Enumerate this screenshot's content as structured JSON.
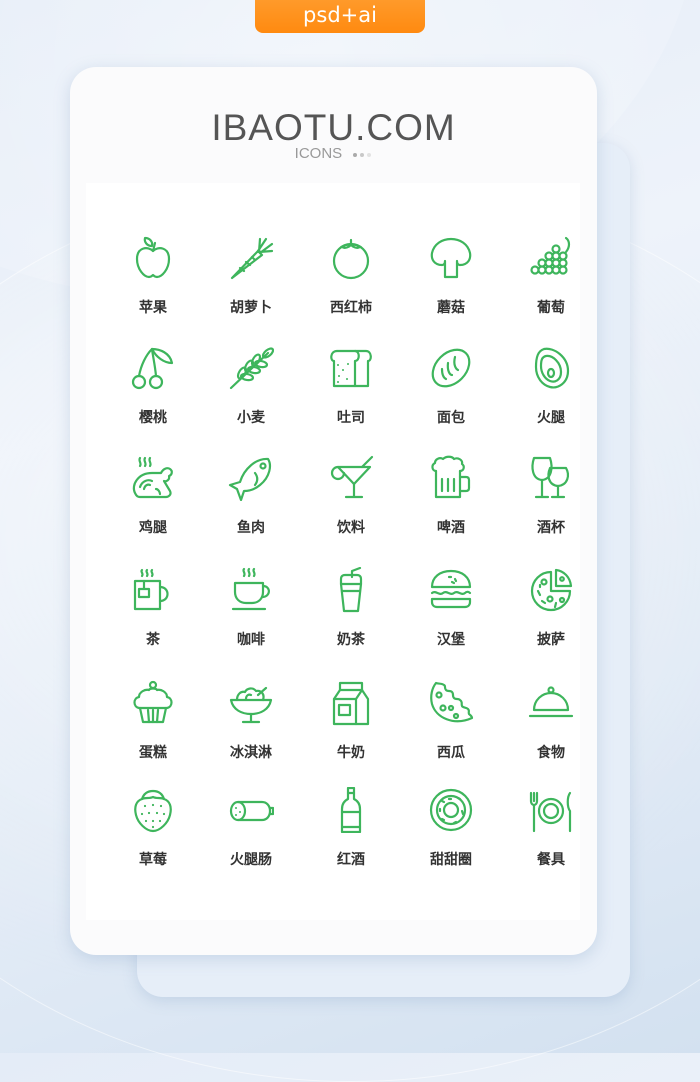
{
  "tag": {
    "label": "psd+ai",
    "color": "#ff8c14"
  },
  "header": {
    "title": "IBAOTU.COM",
    "subtitle": "ICONS",
    "dot_colors": [
      "#aaaaaa",
      "#c8c8c8",
      "#e2e2e2"
    ]
  },
  "accent_color": "#3eb55c",
  "icons": [
    {
      "label": "苹果",
      "icon": "apple-icon"
    },
    {
      "label": "胡萝卜",
      "icon": "carrot-icon"
    },
    {
      "label": "西红柿",
      "icon": "tomato-icon"
    },
    {
      "label": "蘑菇",
      "icon": "mushroom-icon"
    },
    {
      "label": "葡萄",
      "icon": "grapes-icon"
    },
    {
      "label": "樱桃",
      "icon": "cherry-icon"
    },
    {
      "label": "小麦",
      "icon": "wheat-icon"
    },
    {
      "label": "吐司",
      "icon": "toast-icon"
    },
    {
      "label": "面包",
      "icon": "bread-icon"
    },
    {
      "label": "火腿",
      "icon": "ham-icon"
    },
    {
      "label": "鸡腿",
      "icon": "roast-chicken-icon"
    },
    {
      "label": "鱼肉",
      "icon": "fish-icon"
    },
    {
      "label": "饮料",
      "icon": "cocktail-icon"
    },
    {
      "label": "啤酒",
      "icon": "beer-mug-icon"
    },
    {
      "label": "酒杯",
      "icon": "wine-glasses-icon"
    },
    {
      "label": "茶",
      "icon": "tea-mug-icon"
    },
    {
      "label": "咖啡",
      "icon": "coffee-cup-icon"
    },
    {
      "label": "奶茶",
      "icon": "milk-tea-icon"
    },
    {
      "label": "汉堡",
      "icon": "burger-icon"
    },
    {
      "label": "披萨",
      "icon": "pizza-icon"
    },
    {
      "label": "蛋糕",
      "icon": "cupcake-icon"
    },
    {
      "label": "冰淇淋",
      "icon": "ice-cream-icon"
    },
    {
      "label": "牛奶",
      "icon": "milk-carton-icon"
    },
    {
      "label": "西瓜",
      "icon": "cheese-slice-icon"
    },
    {
      "label": "食物",
      "icon": "food-cloche-icon"
    },
    {
      "label": "草莓",
      "icon": "strawberry-icon"
    },
    {
      "label": "火腿肠",
      "icon": "sausage-icon"
    },
    {
      "label": "红酒",
      "icon": "wine-bottle-icon"
    },
    {
      "label": "甜甜圈",
      "icon": "donut-icon"
    },
    {
      "label": "餐具",
      "icon": "tableware-icon"
    }
  ]
}
